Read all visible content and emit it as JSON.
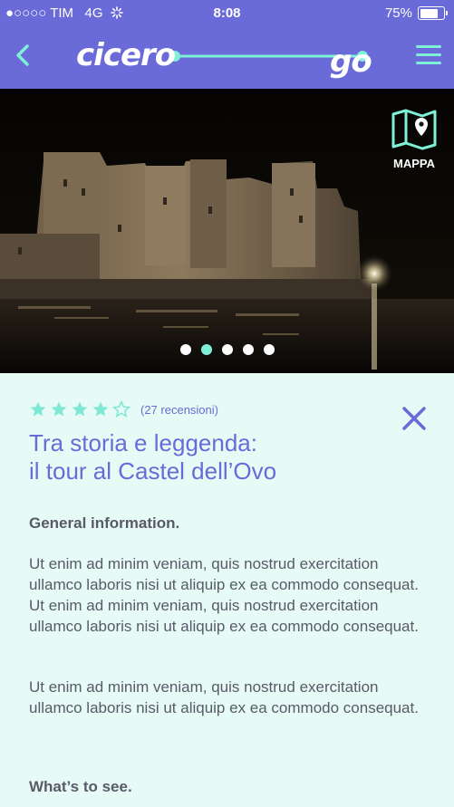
{
  "status_bar": {
    "carrier": "●○○○○ TIM",
    "network": "4G",
    "time": "8:08",
    "battery": "75%"
  },
  "nav": {
    "logo_word1": "cicero",
    "logo_word2": "go"
  },
  "hero": {
    "map_label": "MAPPA",
    "slide_count": 5,
    "active_slide": 2
  },
  "detail": {
    "rating": 4,
    "max_rating": 5,
    "reviews": "(27 recensioni)",
    "title_line1": "Tra storia e leggenda:",
    "title_line2": "il tour al Castel dell’Ovo",
    "section1_heading": "General information.",
    "paragraph1": "Ut enim ad minim veniam, quis nostrud exercitation ullamco laboris nisi ut aliquip ex ea commodo consequat. Ut enim ad minim veniam, quis nostrud exercitation ullamco laboris nisi ut aliquip ex ea commodo consequat.",
    "paragraph2": "Ut enim ad minim veniam, quis nostrud exercitation ullamco laboris nisi ut aliquip ex ea commodo consequat.",
    "section2_heading": "What’s to see."
  },
  "colors": {
    "primary": "#6a6ad8",
    "accent": "#7ff0d8",
    "content_bg": "#e6fbf5",
    "text": "#595968"
  },
  "icons": [
    "back-arrow-icon",
    "menu-icon",
    "map-pin-icon",
    "star-icon",
    "close-icon",
    "wifi-spinner-icon",
    "battery-icon"
  ]
}
